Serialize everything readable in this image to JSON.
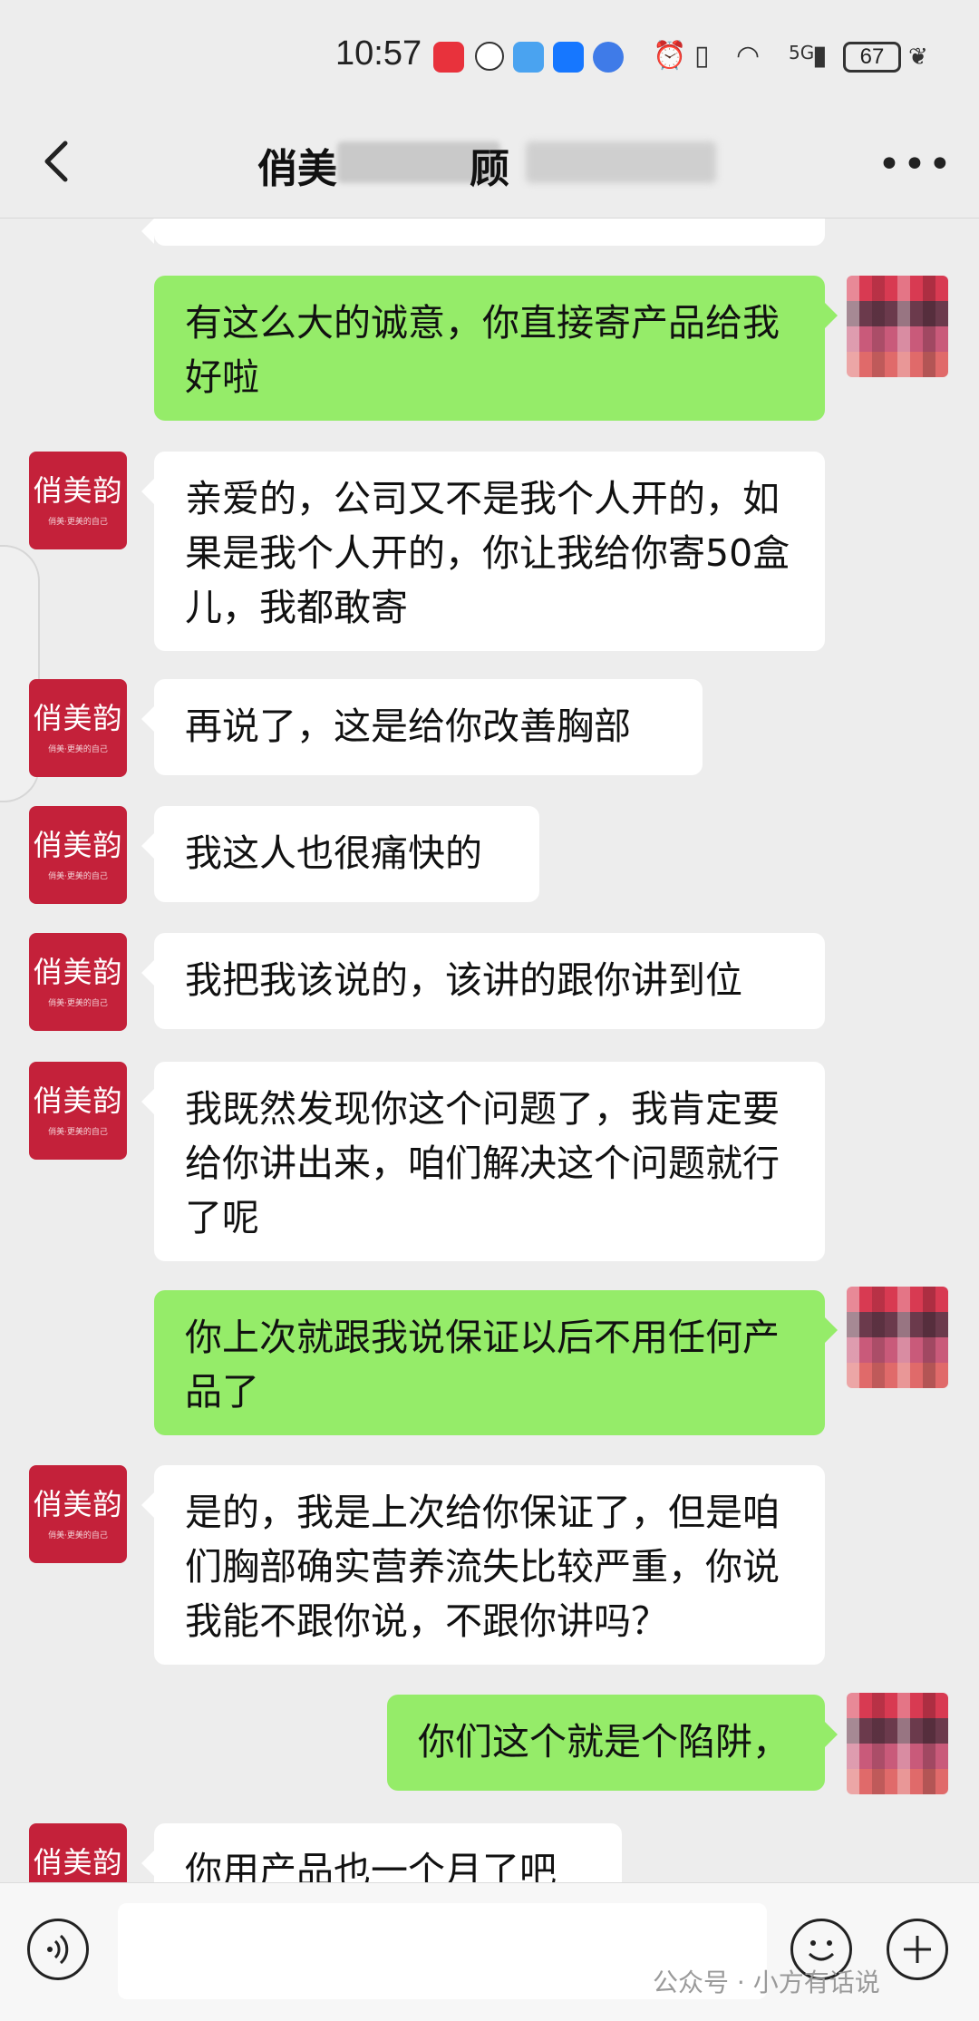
{
  "status_bar": {
    "time": "10:57",
    "battery": "67",
    "network": "5G"
  },
  "header": {
    "title": "俏美",
    "title_suffix": "顾"
  },
  "messages": [
    {
      "side": "out",
      "text": "有这么大的诚意，你直接寄产品给我好啦"
    },
    {
      "side": "in",
      "text": "亲爱的，公司又不是我个人开的，如果是我个人开的，你让我给你寄50盒儿，我都敢寄"
    },
    {
      "side": "in",
      "text": "再说了，这是给你改善胸部"
    },
    {
      "side": "in",
      "text": "我这人也很痛快的"
    },
    {
      "side": "in",
      "text": "我把我该说的，该讲的跟你讲到位"
    },
    {
      "side": "in",
      "text": "我既然发现你这个问题了，我肯定要给你讲出来，咱们解决这个问题就行了呢"
    },
    {
      "side": "out",
      "text": "你上次就跟我说保证以后不用任何产品了"
    },
    {
      "side": "in",
      "text": "是的，我是上次给你保证了，但是咱们胸部确实营养流失比较严重，你说我能不跟你说，不跟你讲吗？"
    },
    {
      "side": "out",
      "text": "你们这个就是个陷阱，"
    },
    {
      "side": "in",
      "text": "你用产品也一个月了吧"
    }
  ],
  "avatar_in": {
    "logo": "俏美韵",
    "tag": "俏美·更美的自己"
  },
  "watermark": "公众号 · 小方有话说",
  "colors": {
    "out_bubble": "#95ec69",
    "in_bubble": "#ffffff",
    "avatar_brand": "#c4213a",
    "background": "#ededed"
  }
}
